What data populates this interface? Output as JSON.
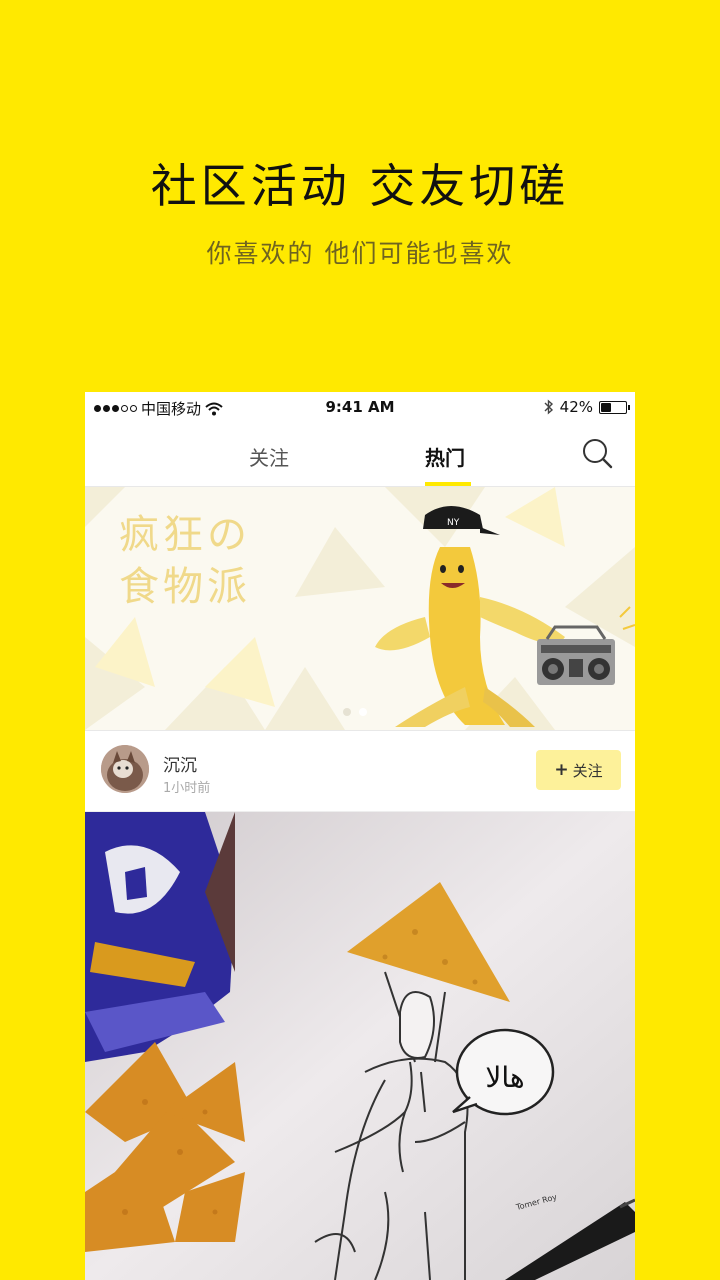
{
  "promo": {
    "headline": "社区活动 交友切磋",
    "subline": "你喜欢的 他们可能也喜欢"
  },
  "status_bar": {
    "carrier": "中国移动",
    "time": "9:41 AM",
    "battery": "42%",
    "battery_level": 0.42,
    "signal_bars": 3,
    "signal_total": 5
  },
  "tabs": {
    "follow_label": "关注",
    "hot_label": "热门",
    "active": "hot"
  },
  "banner": {
    "title_line1": "疯狂の",
    "title_line2": "食物派",
    "page_count": 2,
    "active_page": 2
  },
  "post": {
    "username": "沉沉",
    "time": "1小时前",
    "follow_button": "关注",
    "speech_text": "ﻫﺎﻻ"
  },
  "colors": {
    "brand_yellow": "#FFE900",
    "follow_button_bg": "#fdf19a"
  }
}
